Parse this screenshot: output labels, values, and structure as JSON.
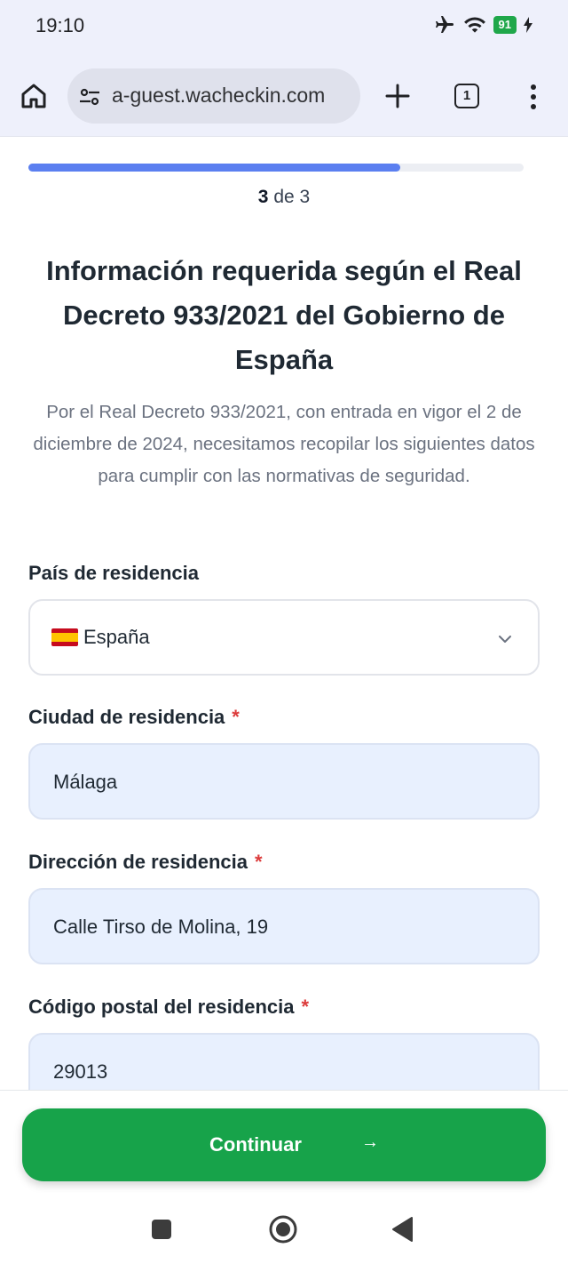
{
  "status_bar": {
    "time": "19:10",
    "battery": "91",
    "icons": [
      "airplane-icon",
      "wifi-icon",
      "battery-icon",
      "charging-icon"
    ]
  },
  "browser": {
    "url": "a-guest.wacheckin.com",
    "tab_count": "1"
  },
  "progress": {
    "current": "3",
    "separator": "de",
    "total": "3",
    "fraction": 0.75
  },
  "page": {
    "title": "Información requerida según el Real Decreto 933/2021 del Gobierno de España",
    "description": "Por el Real Decreto 933/2021, con entrada en vigor el 2 de diciembre de 2024, necesitamos recopilar los siguientes datos para cumplir con las normativas de seguridad."
  },
  "form": {
    "country": {
      "label": "País de residencia",
      "value": "España",
      "flag_icon": "spain-flag-icon"
    },
    "city": {
      "label": "Ciudad de residencia",
      "required_mark": "*",
      "value": "Málaga"
    },
    "address": {
      "label": "Dirección de residencia",
      "required_mark": "*",
      "value": "Calle Tirso de Molina, 19"
    },
    "postal": {
      "label": "Código postal del residencia",
      "required_mark": "*",
      "value": "29013"
    }
  },
  "actions": {
    "continue_label": "Continuar",
    "continue_arrow": "→"
  },
  "colors": {
    "accent": "#17a34a",
    "progress": "#5b7ff0",
    "required": "#dc3b3b",
    "field_bg": "#e8f0fe"
  }
}
